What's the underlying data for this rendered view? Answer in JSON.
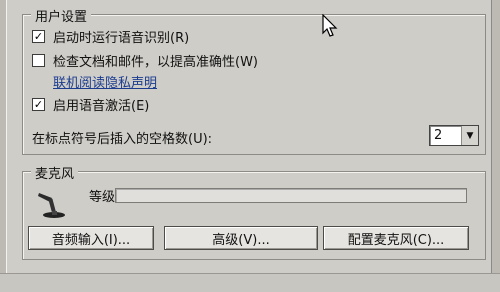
{
  "user_settings": {
    "title": "用户设置",
    "startup_recognition": {
      "label": "启动时运行语音识别(R)",
      "checked": true
    },
    "check_documents": {
      "label": "检查文档和邮件，以提高准确性(W)",
      "checked": false
    },
    "privacy_link": "联机阅读隐私声明",
    "voice_activation": {
      "label": "启用语音激活(E)",
      "checked": true
    },
    "spaces_label": "在标点符号后插入的空格数(U):",
    "spaces_value": "2"
  },
  "microphone": {
    "title": "麦克风",
    "level_label": "等级",
    "level_value": 0,
    "buttons": {
      "audio_input": "音频输入(I)...",
      "advanced": "高级(V)...",
      "configure": "配置麦克风(C)..."
    }
  },
  "icons": {
    "check": "✓",
    "dropdown_arrow": "▼"
  }
}
